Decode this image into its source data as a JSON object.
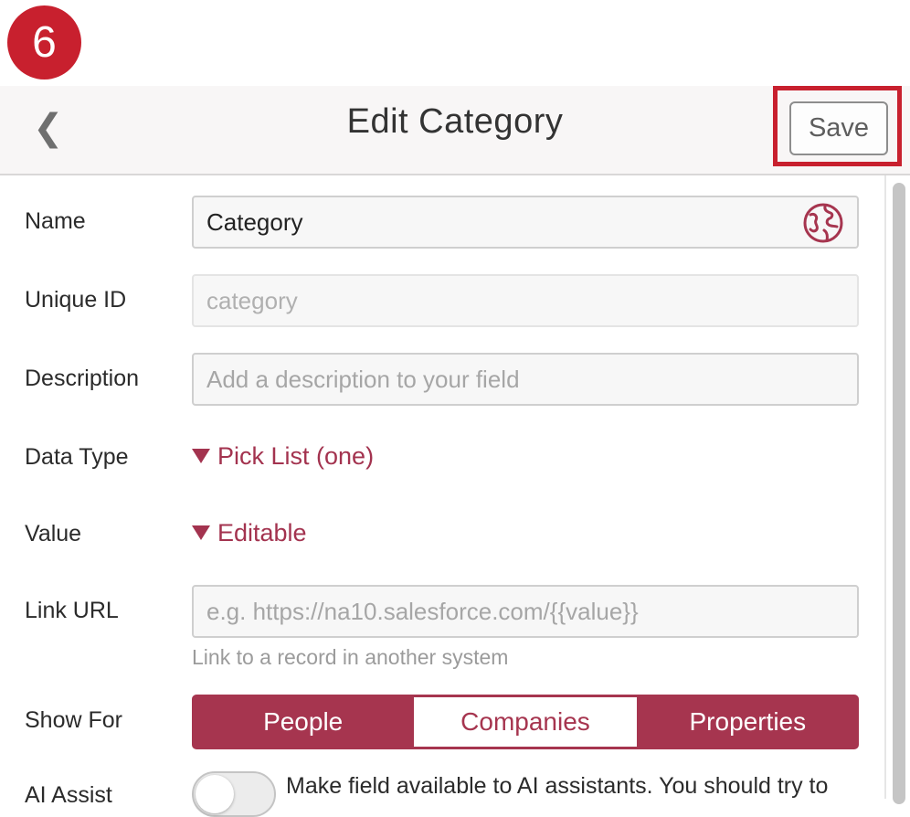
{
  "step_badge": "6",
  "header": {
    "back_icon": "chevron-left-icon",
    "title": "Edit Category",
    "save_label": "Save"
  },
  "form": {
    "name": {
      "label": "Name",
      "value": "Category",
      "icon": "globe-icon"
    },
    "unique_id": {
      "label": "Unique ID",
      "value": "category"
    },
    "description": {
      "label": "Description",
      "placeholder": "Add a description to your field"
    },
    "data_type": {
      "label": "Data Type",
      "value": "Pick List (one)"
    },
    "value": {
      "label": "Value",
      "value": "Editable"
    },
    "link_url": {
      "label": "Link URL",
      "placeholder": "e.g. https://na10.salesforce.com/{{value}}",
      "hint": "Link to a record in another system"
    },
    "show_for": {
      "label": "Show For",
      "options": [
        "People",
        "Companies",
        "Properties"
      ],
      "selected": "Companies"
    },
    "ai_assist": {
      "label": "AI Assist",
      "enabled": false,
      "description": "Make field available to AI assistants. You should try to"
    }
  },
  "colors": {
    "accent": "#a6354f",
    "highlight": "#c8202e",
    "header_bg": "#f8f6f6"
  }
}
